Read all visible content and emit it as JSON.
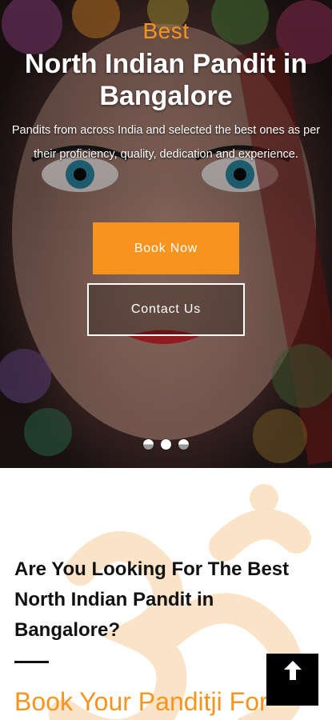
{
  "hero": {
    "eyebrow": "Best",
    "title": "North Indian Pandit in Bangalore",
    "description": "Pandits from across India and selected the best ones as per their proficiency, quality, dedication and experience.",
    "book_button": "Book Now",
    "contact_button": "Contact Us",
    "slides": {
      "count": 3,
      "active_index": 1
    }
  },
  "section": {
    "heading": "Are You Looking For The Best North Indian Pandit in Bangalore?",
    "subheading": "Book Your Panditji For"
  },
  "colors": {
    "accent": "#f7941d",
    "text_dark": "#111111",
    "scroll_button": "#000000"
  },
  "icons": {
    "scroll_top": "arrow-up-icon",
    "watermark": "om-symbol-icon"
  }
}
